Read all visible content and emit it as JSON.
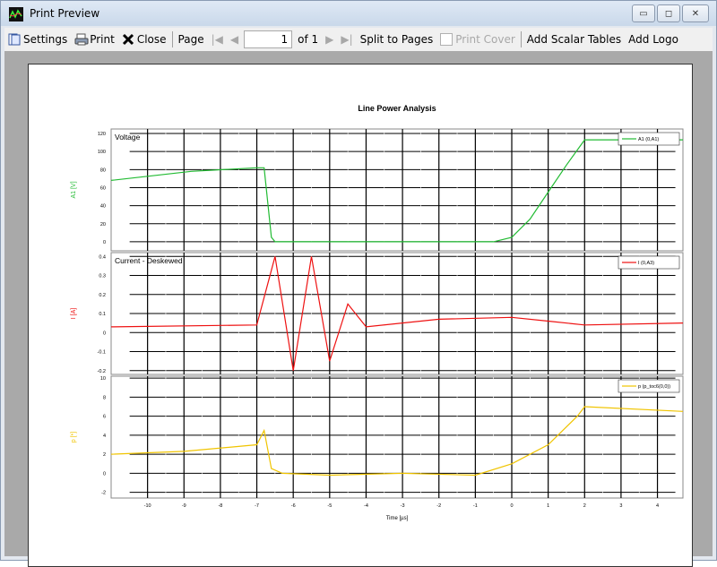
{
  "window": {
    "title": "Print Preview",
    "buttons": {
      "minimize": "▭",
      "maximize": "◻",
      "close": "✕"
    }
  },
  "toolbar": {
    "settings_label": "Settings",
    "print_label": "Print",
    "close_label": "Close",
    "page_label": "Page",
    "page_value": "1",
    "of_label": "of 1",
    "split_label": "Split to Pages",
    "print_cover_label": "Print Cover",
    "scalar_tables_label": "Add Scalar Tables",
    "add_logo_label": "Add Logo"
  },
  "colors": {
    "voltage": "#22bb33",
    "current": "#ee1111",
    "power": "#f0c400",
    "grid": "#000000"
  },
  "chart_data": [
    {
      "type": "line",
      "title": "Line Power Analysis",
      "subtitle": "Voltage",
      "ylabel": "A1 [V]",
      "legend": "A1 (0,A1)",
      "legend_position": "top-right",
      "ylim": [
        -10,
        125
      ],
      "yticks": [
        0,
        20,
        40,
        60,
        80,
        100,
        120
      ],
      "series": [
        {
          "name": "A1 (0,A1)",
          "x": [
            -11,
            -8.8,
            -7,
            -6.8,
            -6.6,
            -6.5,
            -5,
            -3,
            -1,
            -0.5,
            0,
            0.5,
            1,
            1.5,
            2,
            2.2,
            4.7
          ],
          "y": [
            68,
            78,
            82,
            82,
            5,
            0,
            0,
            0,
            0,
            0,
            5,
            25,
            55,
            85,
            113,
            113,
            113
          ]
        }
      ]
    },
    {
      "type": "line",
      "subtitle": "Current - Deskewed",
      "ylabel": "I [A]",
      "legend": "I (0,A3)",
      "legend_position": "top-right",
      "ylim": [
        -0.22,
        0.42
      ],
      "yticks": [
        -0.2,
        -0.1,
        0.0,
        0.1,
        0.2,
        0.3,
        0.4
      ],
      "series": [
        {
          "name": "I (0,A3)",
          "x": [
            -11,
            -7,
            -6.5,
            -6,
            -5.5,
            -5,
            -4.5,
            -4,
            -2,
            0,
            1,
            2,
            4.7
          ],
          "y": [
            0.03,
            0.04,
            0.4,
            -0.2,
            0.4,
            -0.15,
            0.15,
            0.03,
            0.07,
            0.08,
            0.06,
            0.04,
            0.05
          ]
        }
      ]
    },
    {
      "type": "line",
      "subtitle": "",
      "ylabel": "p [*]",
      "xlabel": "Time [µs]",
      "legend": "p (p_toc6(0,0))",
      "legend_position": "top-right",
      "ylim": [
        -2.6,
        10.2
      ],
      "yticks": [
        -2,
        0,
        2,
        4,
        6,
        8,
        10
      ],
      "x_ticks": [
        -10,
        -9,
        -8,
        -7,
        -6,
        -5,
        -4,
        -3,
        -2,
        -1,
        0,
        1,
        2,
        3,
        4
      ],
      "xlim": [
        -11,
        4.7
      ],
      "series": [
        {
          "name": "p (p_toc6(0,0))",
          "x": [
            -11,
            -9,
            -7,
            -6.8,
            -6.6,
            -6.3,
            -5,
            -3,
            -1,
            0,
            1,
            1.8,
            2,
            4.7
          ],
          "y": [
            2,
            2.3,
            3,
            4.5,
            0.5,
            0,
            -0.2,
            0,
            -0.2,
            1,
            3,
            6,
            7,
            6.5
          ]
        }
      ]
    }
  ]
}
